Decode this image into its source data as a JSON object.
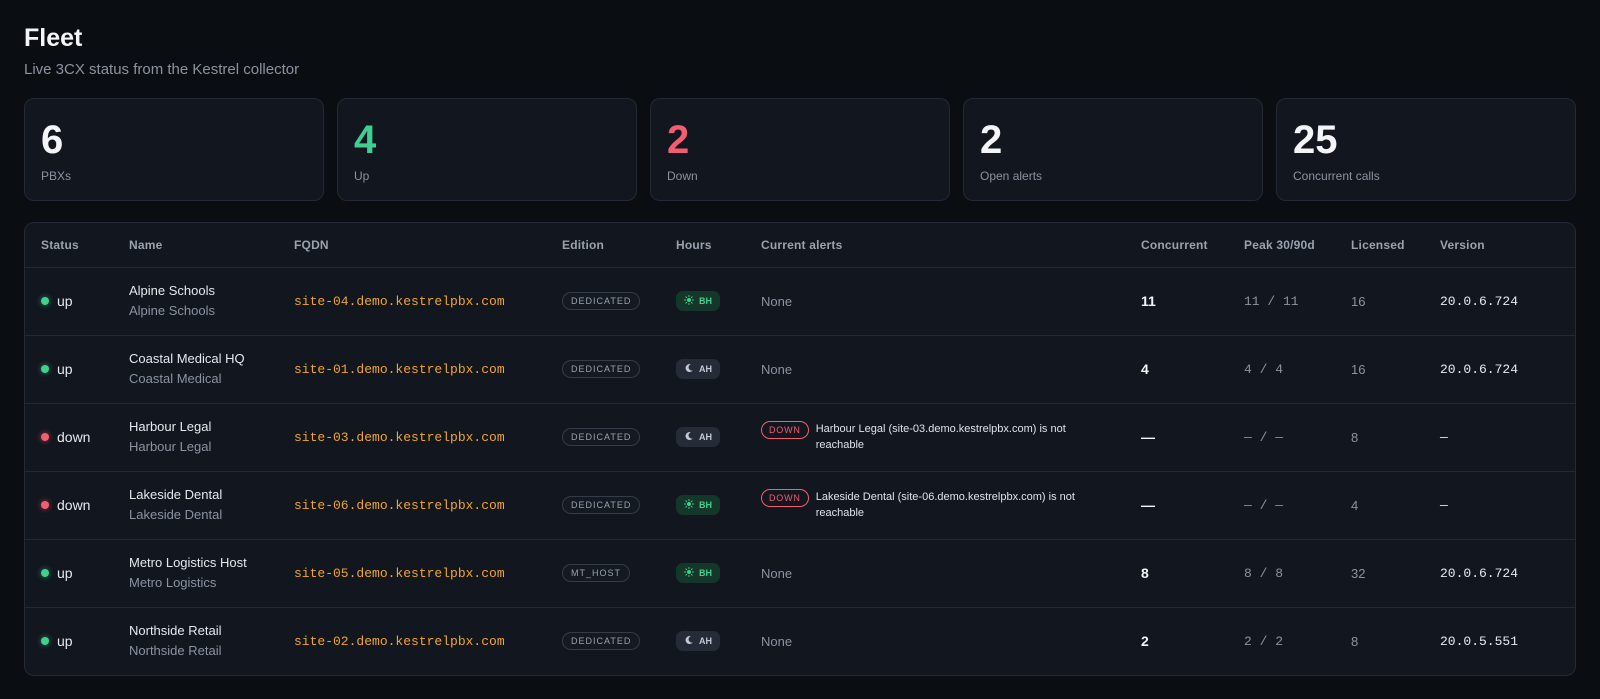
{
  "header": {
    "title": "Fleet",
    "subtitle": "Live 3CX status from the Kestrel collector"
  },
  "stats": [
    {
      "value": "6",
      "label": "PBXs",
      "color": "#f3f5f8"
    },
    {
      "value": "4",
      "label": "Up",
      "color": "#3fcf8e"
    },
    {
      "value": "2",
      "label": "Down",
      "color": "#f25d72"
    },
    {
      "value": "2",
      "label": "Open alerts",
      "color": "#f3f5f8"
    },
    {
      "value": "25",
      "label": "Concurrent calls",
      "color": "#f3f5f8"
    }
  ],
  "table": {
    "columns": [
      "Status",
      "Name",
      "FQDN",
      "Edition",
      "Hours",
      "Current alerts",
      "Concurrent",
      "Peak 30/90d",
      "Licensed",
      "Version"
    ],
    "rows": [
      {
        "status": "up",
        "name": "Alpine Schools",
        "customer": "Alpine Schools",
        "fqdn": "site-04.demo.kestrelpbx.com",
        "edition": "DEDICATED",
        "hours": "BH",
        "hours_icon": "sun-icon",
        "alert": "None",
        "alert_badge": "",
        "concurrent": "11",
        "peak": "11 / 11",
        "licensed": "16",
        "version": "20.0.6.724"
      },
      {
        "status": "up",
        "name": "Coastal Medical HQ",
        "customer": "Coastal Medical",
        "fqdn": "site-01.demo.kestrelpbx.com",
        "edition": "DEDICATED",
        "hours": "AH",
        "hours_icon": "moon-icon",
        "alert": "None",
        "alert_badge": "",
        "concurrent": "4",
        "peak": "4 / 4",
        "licensed": "16",
        "version": "20.0.6.724"
      },
      {
        "status": "down",
        "name": "Harbour Legal",
        "customer": "Harbour Legal",
        "fqdn": "site-03.demo.kestrelpbx.com",
        "edition": "DEDICATED",
        "hours": "AH",
        "hours_icon": "moon-icon",
        "alert": "Harbour Legal (site-03.demo.kestrelpbx.com) is not reachable",
        "alert_badge": "DOWN",
        "concurrent": "—",
        "peak": "— / —",
        "licensed": "8",
        "version": "—"
      },
      {
        "status": "down",
        "name": "Lakeside Dental",
        "customer": "Lakeside Dental",
        "fqdn": "site-06.demo.kestrelpbx.com",
        "edition": "DEDICATED",
        "hours": "BH",
        "hours_icon": "sun-icon",
        "alert": "Lakeside Dental (site-06.demo.kestrelpbx.com) is not reachable",
        "alert_badge": "DOWN",
        "concurrent": "—",
        "peak": "— / —",
        "licensed": "4",
        "version": "—"
      },
      {
        "status": "up",
        "name": "Metro Logistics Host",
        "customer": "Metro Logistics",
        "fqdn": "site-05.demo.kestrelpbx.com",
        "edition": "MT_HOST",
        "hours": "BH",
        "hours_icon": "sun-icon",
        "alert": "None",
        "alert_badge": "",
        "concurrent": "8",
        "peak": "8 / 8",
        "licensed": "32",
        "version": "20.0.6.724"
      },
      {
        "status": "up",
        "name": "Northside Retail",
        "customer": "Northside Retail",
        "fqdn": "site-02.demo.kestrelpbx.com",
        "edition": "DEDICATED",
        "hours": "AH",
        "hours_icon": "moon-icon",
        "alert": "None",
        "alert_badge": "",
        "concurrent": "2",
        "peak": "2 / 2",
        "licensed": "8",
        "version": "20.0.5.551"
      }
    ]
  }
}
